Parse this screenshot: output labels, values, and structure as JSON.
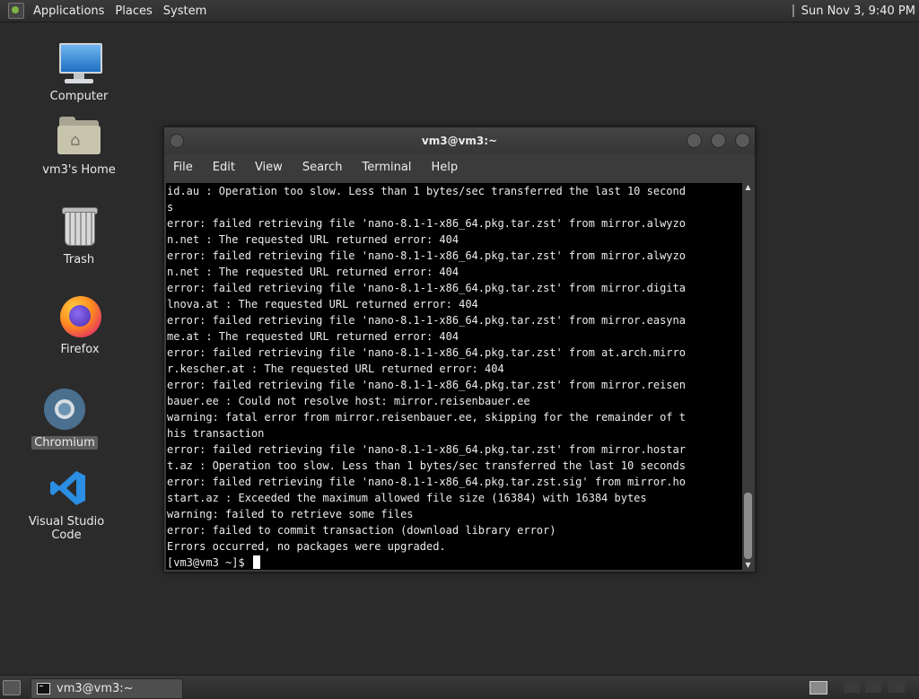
{
  "top_panel": {
    "menus": [
      "Applications",
      "Places",
      "System"
    ],
    "clock": "Sun Nov 3, 9:40 PM"
  },
  "desktop_icons": [
    {
      "label": "Computer",
      "icon": "computer-icon"
    },
    {
      "label": "vm3's Home",
      "icon": "home-folder-icon"
    },
    {
      "label": "Trash",
      "icon": "trash-icon"
    },
    {
      "label": "Firefox",
      "icon": "firefox-icon"
    },
    {
      "label": "Chromium",
      "icon": "chromium-icon",
      "selected": true
    },
    {
      "label": "Visual Studio Code",
      "icon": "vscode-icon"
    }
  ],
  "terminal": {
    "title": "vm3@vm3:~",
    "menu": [
      "File",
      "Edit",
      "View",
      "Search",
      "Terminal",
      "Help"
    ],
    "lines": [
      "id.au : Operation too slow. Less than 1 bytes/sec transferred the last 10 second",
      "s",
      "error: failed retrieving file 'nano-8.1-1-x86_64.pkg.tar.zst' from mirror.alwyzo",
      "n.net : The requested URL returned error: 404",
      "error: failed retrieving file 'nano-8.1-1-x86_64.pkg.tar.zst' from mirror.alwyzo",
      "n.net : The requested URL returned error: 404",
      "error: failed retrieving file 'nano-8.1-1-x86_64.pkg.tar.zst' from mirror.digita",
      "lnova.at : The requested URL returned error: 404",
      "error: failed retrieving file 'nano-8.1-1-x86_64.pkg.tar.zst' from mirror.easyna",
      "me.at : The requested URL returned error: 404",
      "error: failed retrieving file 'nano-8.1-1-x86_64.pkg.tar.zst' from at.arch.mirro",
      "r.kescher.at : The requested URL returned error: 404",
      "error: failed retrieving file 'nano-8.1-1-x86_64.pkg.tar.zst' from mirror.reisen",
      "bauer.ee : Could not resolve host: mirror.reisenbauer.ee",
      "warning: fatal error from mirror.reisenbauer.ee, skipping for the remainder of t",
      "his transaction",
      "error: failed retrieving file 'nano-8.1-1-x86_64.pkg.tar.zst' from mirror.hostar",
      "t.az : Operation too slow. Less than 1 bytes/sec transferred the last 10 seconds",
      "error: failed retrieving file 'nano-8.1-1-x86_64.pkg.tar.zst.sig' from mirror.ho",
      "start.az : Exceeded the maximum allowed file size (16384) with 16384 bytes",
      "warning: failed to retrieve some files",
      "error: failed to commit transaction (download library error)",
      "Errors occurred, no packages were upgraded."
    ],
    "prompt": "[vm3@vm3 ~]$ "
  },
  "bottom_panel": {
    "task_label": "vm3@vm3:~"
  }
}
